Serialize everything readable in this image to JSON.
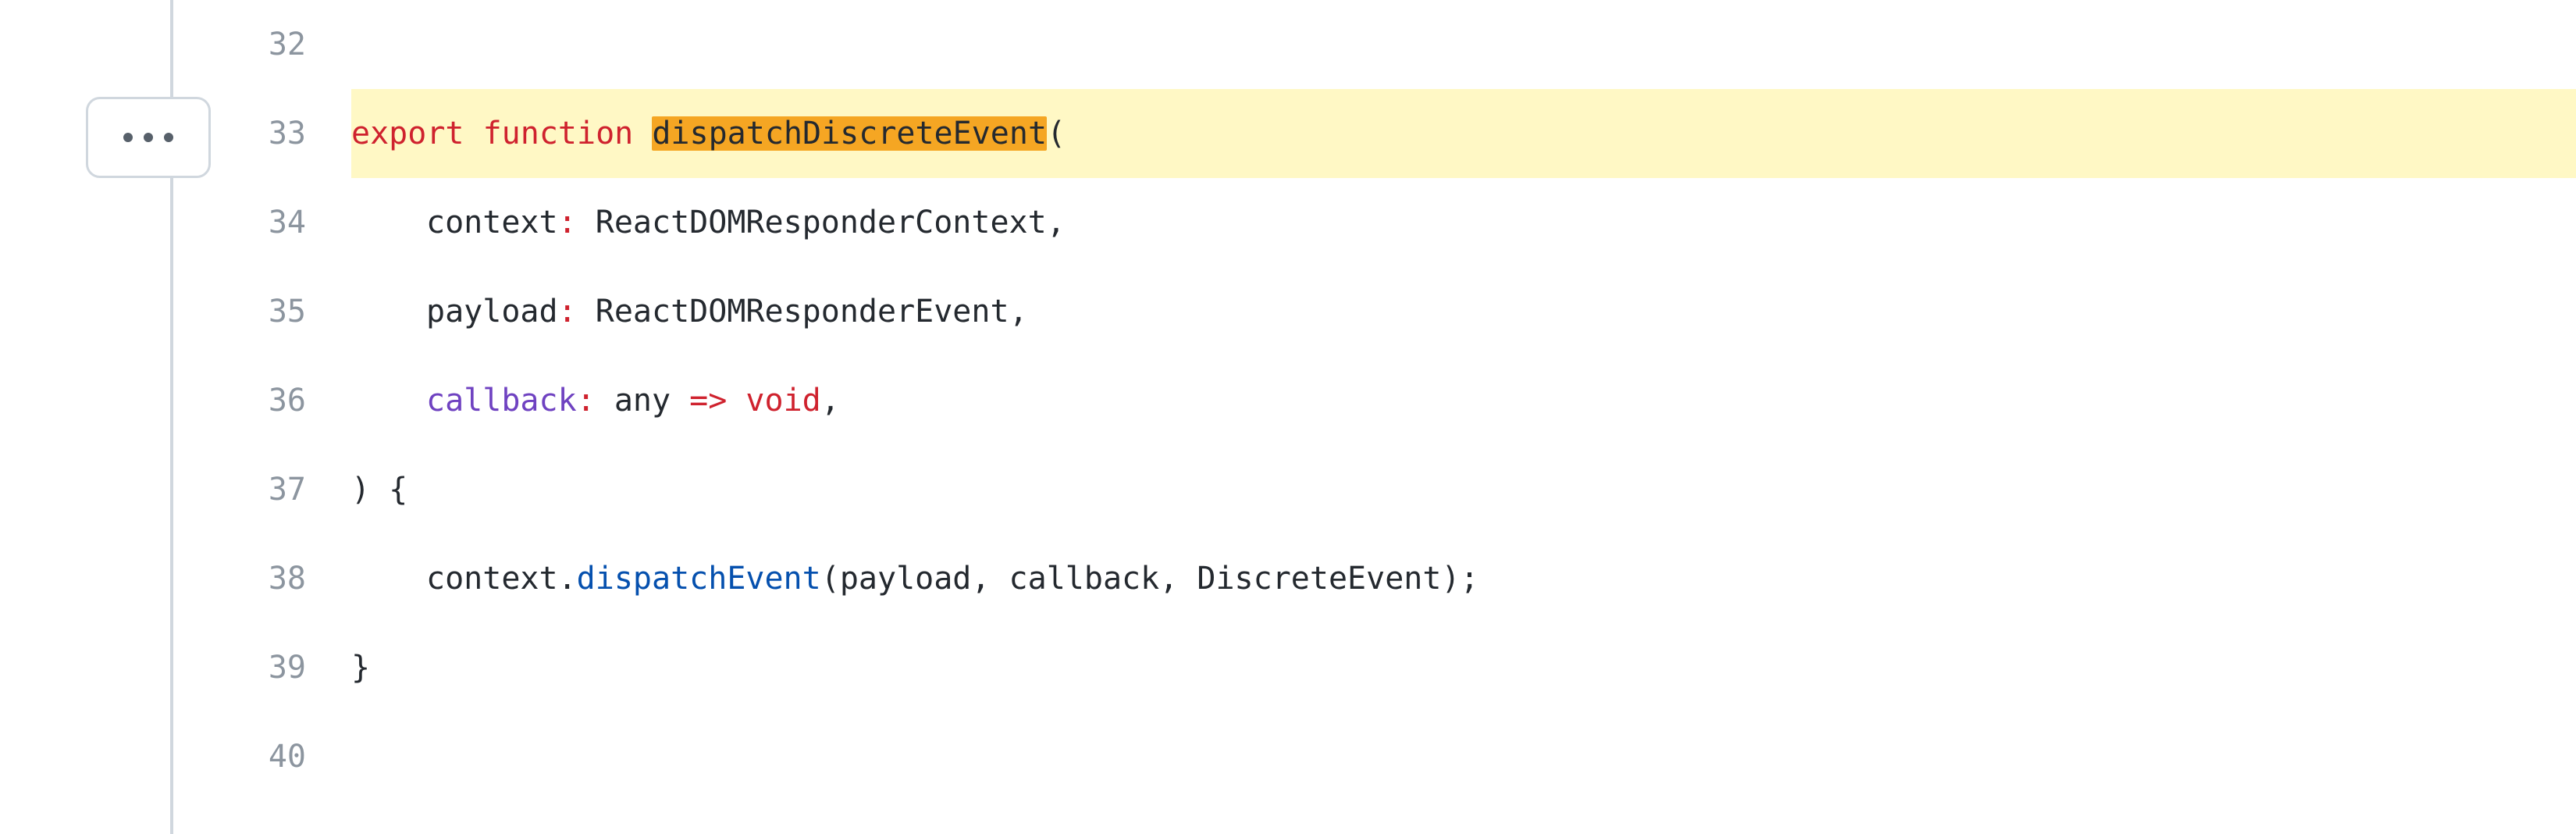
{
  "gutter": {
    "more_button_name": "more-actions"
  },
  "lines": [
    {
      "num": "32",
      "highlighted": false,
      "segments": []
    },
    {
      "num": "33",
      "highlighted": true,
      "segments": [
        {
          "cls": "tok-kw",
          "text": "export "
        },
        {
          "cls": "tok-kw",
          "text": "function "
        },
        {
          "cls": "fn-hl",
          "text": "dispatchDiscreteEvent"
        },
        {
          "cls": "tok-punc",
          "text": "("
        }
      ]
    },
    {
      "num": "34",
      "highlighted": false,
      "segments": [
        {
          "cls": "indent2",
          "text": ""
        },
        {
          "cls": "tok-plain",
          "text": "context"
        },
        {
          "cls": "tok-kw",
          "text": ": "
        },
        {
          "cls": "tok-type",
          "text": "ReactDOMResponderContext"
        },
        {
          "cls": "tok-punc",
          "text": ","
        }
      ]
    },
    {
      "num": "35",
      "highlighted": false,
      "segments": [
        {
          "cls": "indent2",
          "text": ""
        },
        {
          "cls": "tok-plain",
          "text": "payload"
        },
        {
          "cls": "tok-kw",
          "text": ": "
        },
        {
          "cls": "tok-type",
          "text": "ReactDOMResponderEvent"
        },
        {
          "cls": "tok-punc",
          "text": ","
        }
      ]
    },
    {
      "num": "36",
      "highlighted": false,
      "segments": [
        {
          "cls": "indent2",
          "text": ""
        },
        {
          "cls": "tok-param",
          "text": "callback"
        },
        {
          "cls": "tok-kw",
          "text": ": "
        },
        {
          "cls": "tok-type",
          "text": "any "
        },
        {
          "cls": "tok-kw",
          "text": "=> void"
        },
        {
          "cls": "tok-punc",
          "text": ","
        }
      ]
    },
    {
      "num": "37",
      "highlighted": false,
      "segments": [
        {
          "cls": "tok-punc",
          "text": ") {"
        }
      ]
    },
    {
      "num": "38",
      "highlighted": false,
      "segments": [
        {
          "cls": "indent2",
          "text": ""
        },
        {
          "cls": "tok-plain",
          "text": "context."
        },
        {
          "cls": "tok-call",
          "text": "dispatchEvent"
        },
        {
          "cls": "tok-plain",
          "text": "(payload, callback, DiscreteEvent);"
        }
      ]
    },
    {
      "num": "39",
      "highlighted": false,
      "segments": [
        {
          "cls": "tok-punc",
          "text": "}"
        }
      ]
    },
    {
      "num": "40",
      "highlighted": false,
      "segments": []
    }
  ]
}
